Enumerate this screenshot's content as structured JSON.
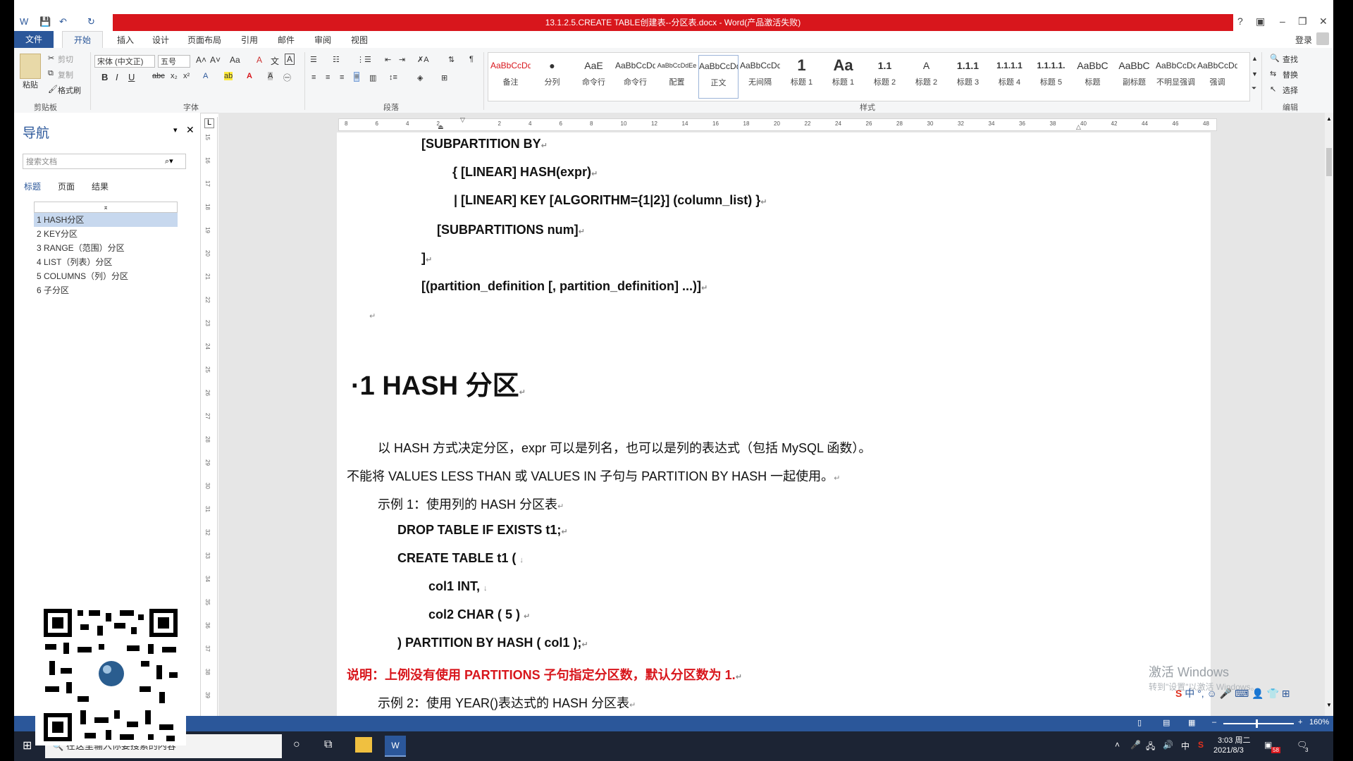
{
  "window": {
    "title": "13.1.2.5.CREATE TABLE创建表--分区表.docx - Word(产品激活失败)",
    "login": "登录"
  },
  "ribbon": {
    "tabs": [
      "文件",
      "开始",
      "插入",
      "设计",
      "页面布局",
      "引用",
      "邮件",
      "审阅",
      "视图"
    ],
    "clipboard": {
      "paste": "粘贴",
      "cut": "剪切",
      "copy": "复制",
      "format_painter": "格式刷",
      "label": "剪贴板"
    },
    "font": {
      "name": "宋体 (中文正)",
      "size": "五号",
      "label": "字体"
    },
    "paragraph_label": "段落",
    "styles_label": "样式",
    "styles": [
      {
        "preview": "AaBbCcDd",
        "name": "备注",
        "color": "#d8161c"
      },
      {
        "preview": "●",
        "name": "分列"
      },
      {
        "preview": "AaE",
        "name": "命令行"
      },
      {
        "preview": "AaBbCcDd",
        "name": "命令行"
      },
      {
        "preview": "AaBbCcDdEe",
        "name": "配置"
      },
      {
        "preview": "AaBbCcDd",
        "name": "正文"
      },
      {
        "preview": "AaBbCcDd",
        "name": "无间隔"
      },
      {
        "preview": "1",
        "name": "标题 1"
      },
      {
        "preview": "Aa",
        "name": "标题 1"
      },
      {
        "preview": "1.1",
        "name": "标题 2"
      },
      {
        "preview": "A",
        "name": "标题 2"
      },
      {
        "preview": "1.1.1",
        "name": "标题 3"
      },
      {
        "preview": "1.1.1.1",
        "name": "标题 4"
      },
      {
        "preview": "1.1.1.1.",
        "name": "标题 5"
      },
      {
        "preview": "AaBbC",
        "name": "标题"
      },
      {
        "preview": "AaBbC",
        "name": "副标题"
      },
      {
        "preview": "AaBbCcDd",
        "name": "不明显强调"
      },
      {
        "preview": "AaBbCcDd",
        "name": "强调"
      }
    ],
    "editing": {
      "find": "查找",
      "replace": "替换",
      "select": "选择",
      "label": "编辑"
    }
  },
  "nav": {
    "title": "导航",
    "search_placeholder": "搜索文档",
    "tabs": [
      "标题",
      "页面",
      "结果"
    ],
    "items": [
      "1 HASH分区",
      "2 KEY分区",
      "3 RANGE（范围）分区",
      "4 LIST（列表）分区",
      "5 COLUMNS（列）分区",
      "6 子分区"
    ]
  },
  "ruler": {
    "h_ticks": [
      "8",
      "6",
      "4",
      "2",
      "",
      "2",
      "4",
      "6",
      "8",
      "10",
      "12",
      "14",
      "16",
      "18",
      "20",
      "22",
      "24",
      "26",
      "28",
      "30",
      "32",
      "34",
      "36",
      "38",
      "40",
      "42",
      "44",
      "46",
      "48"
    ],
    "v_ticks": [
      "15",
      "16",
      "17",
      "18",
      "19",
      "20",
      "21",
      "22",
      "23",
      "24",
      "25",
      "26",
      "27",
      "28",
      "29",
      "30",
      "31",
      "32",
      "33",
      "34",
      "35",
      "36",
      "37",
      "38",
      "39"
    ]
  },
  "doc": {
    "lines": [
      "[SUBPARTITION BY",
      "{ [LINEAR] HASH(expr)",
      "| [LINEAR] KEY [ALGORITHM={1|2}] (column_list) }",
      "[SUBPARTITIONS num]",
      "]",
      "[(partition_definition [, partition_definition] ...)]"
    ],
    "heading": "1  HASH 分区",
    "para1": "以 HASH 方式决定分区，expr 可以是列名，也可以是列的表达式（包括 MySQL 函数）。",
    "para2": "不能将 VALUES LESS THAN 或 VALUES IN 子句与 PARTITION BY HASH 一起使用。",
    "example1": "示例 1：使用列的 HASH 分区表",
    "code": [
      "DROP TABLE IF EXISTS t1;",
      "CREATE TABLE t1 (",
      "col1 INT,",
      "col2 CHAR ( 5 )",
      ")    PARTITION BY HASH ( col1 );"
    ],
    "note": "说明：上例没有使用 PARTITIONS 子句指定分区数，默认分区数为 1.",
    "example2": "示例 2：使用 YEAR()表达式的 HASH 分区表"
  },
  "watermark": {
    "line1": "激活 Windows",
    "line2": "转到\"设置\"以激活 Windows。"
  },
  "status": {
    "zoom": "160%"
  },
  "taskbar": {
    "search_text": "在这里输入你要搜索的内容",
    "time": "3:03 周二",
    "date": "2021/8/3",
    "ime": "中",
    "badge": "58",
    "notif": "3"
  }
}
